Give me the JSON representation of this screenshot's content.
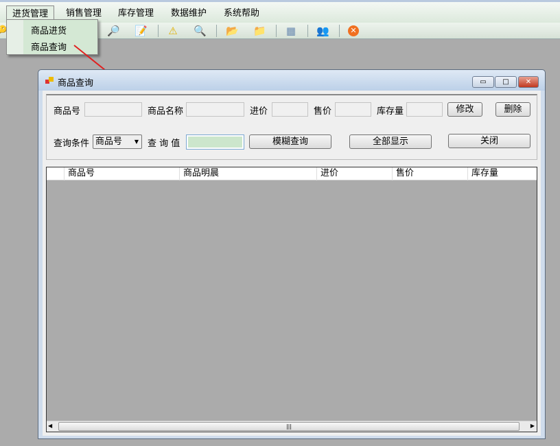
{
  "menubar": {
    "items": [
      "进货管理",
      "销售管理",
      "库存管理",
      "数据维护",
      "系统帮助"
    ]
  },
  "dropdown": {
    "items": [
      "商品进货",
      "商品查询"
    ]
  },
  "toolbar": {
    "icons": [
      "key-icon",
      "search-map-icon",
      "edit-icon",
      "warning-icon",
      "magnifier-icon",
      "folder-export-icon",
      "copy-folder-icon",
      "calculator-icon",
      "users-icon",
      "exit-icon"
    ]
  },
  "window": {
    "title": "商品查询",
    "fields": {
      "id_label": "商品号",
      "name_label": "商品名称",
      "cost_label": "进价",
      "price_label": "售价",
      "stock_label": "库存量",
      "id": "",
      "name": "",
      "cost": "",
      "price": "",
      "stock": ""
    },
    "buttons": {
      "edit": "修改",
      "delete": "删除",
      "fuzzy": "模糊查询",
      "show_all": "全部显示",
      "close": "关闭"
    },
    "query": {
      "cond_label": "查询条件",
      "cond_value": "商品号",
      "value_label": "查 询 值",
      "value": ""
    },
    "grid": {
      "columns": [
        "商品号",
        "商品明晨",
        "进价",
        "售价",
        "库存量"
      ]
    }
  },
  "colors": {
    "query_input": "#cce6cc",
    "arrow": "#e02020"
  }
}
